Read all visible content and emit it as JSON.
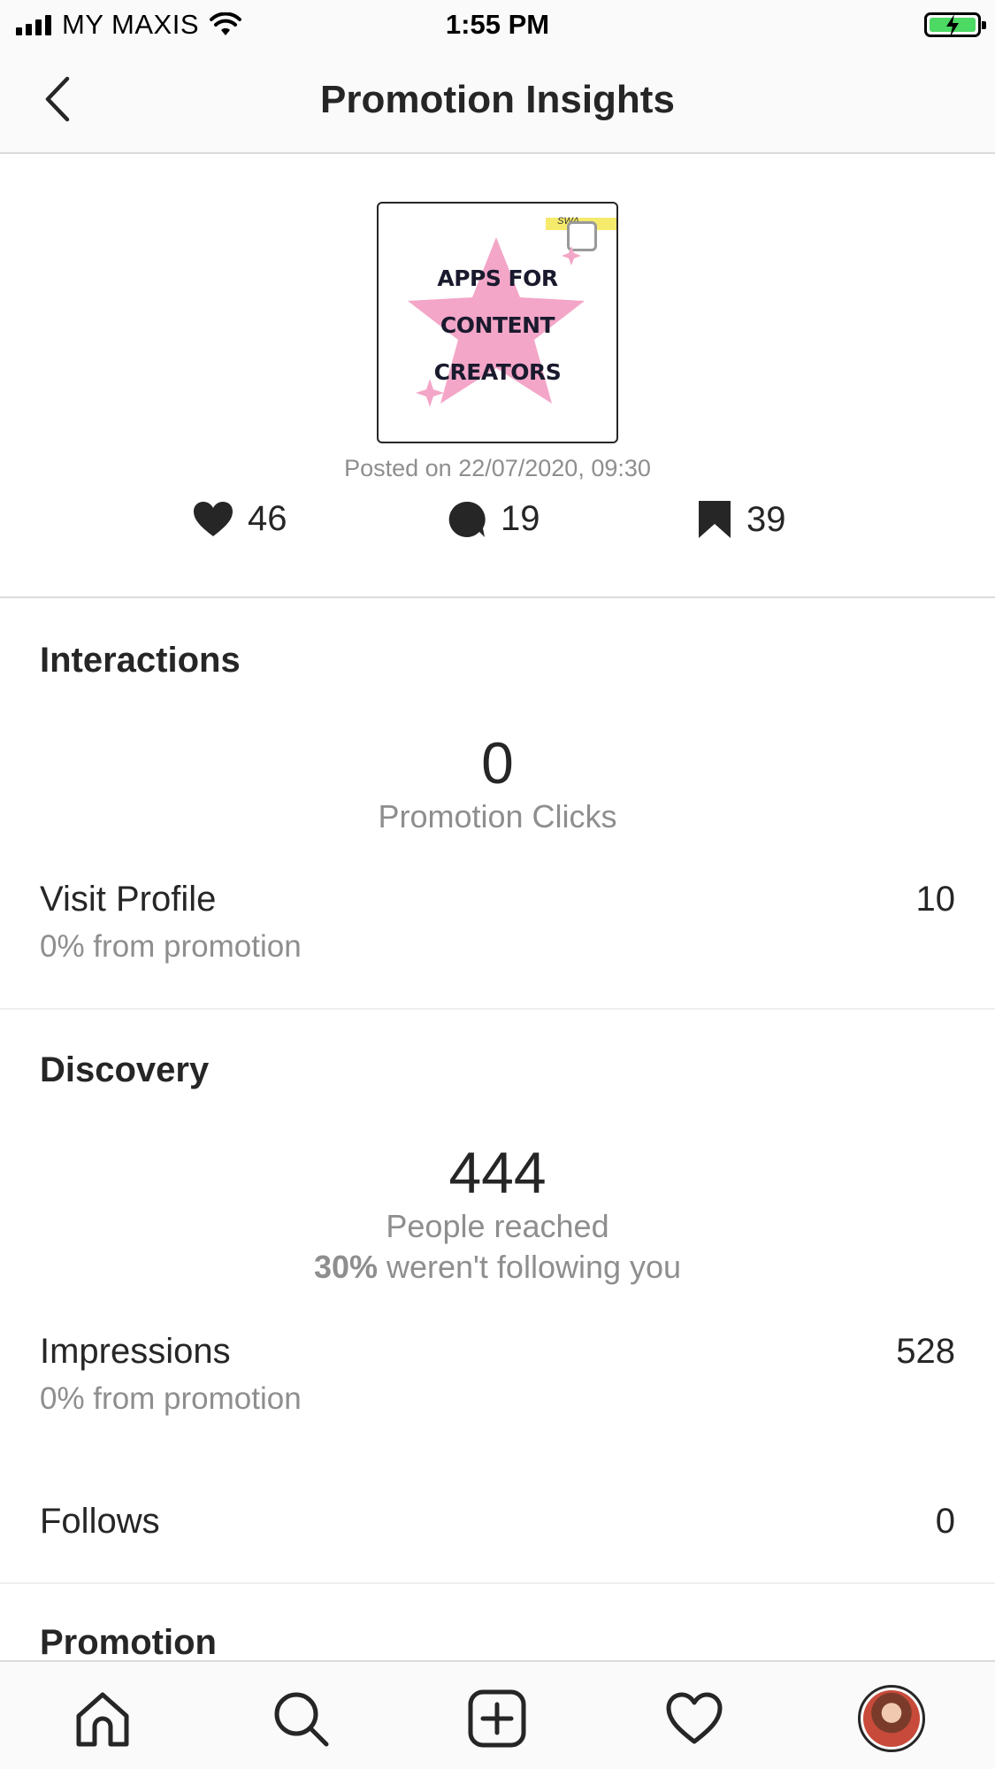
{
  "status_bar": {
    "carrier": "MY MAXIS",
    "time": "1:55 PM"
  },
  "nav": {
    "title": "Promotion Insights"
  },
  "post": {
    "thumbnail_text": [
      "APPS FOR",
      "CONTENT",
      "CREATORS"
    ],
    "thumbnail_badge": "SWA",
    "posted": "Posted on 22/07/2020, 09:30",
    "likes": "46",
    "comments": "19",
    "saves": "39"
  },
  "interactions": {
    "title": "Interactions",
    "promotion_clicks_value": "0",
    "promotion_clicks_label": "Promotion Clicks",
    "visit_profile_label": "Visit Profile",
    "visit_profile_sub": "0% from promotion",
    "visit_profile_value": "10"
  },
  "discovery": {
    "title": "Discovery",
    "reach_value": "444",
    "reach_label": "People reached",
    "not_following_pct": "30%",
    "not_following_text": " weren't following you",
    "impressions_label": "Impressions",
    "impressions_sub": "0% from promotion",
    "impressions_value": "528",
    "follows_label": "Follows",
    "follows_value": "0"
  },
  "promotion": {
    "title": "Promotion"
  },
  "tab_bar": {
    "tabs": [
      "home-icon",
      "search-icon",
      "add-post-icon",
      "heart-icon",
      "profile-avatar"
    ]
  },
  "colors": {
    "text_primary": "#262626",
    "text_secondary": "#8e8e8e",
    "divider": "#dbdbdb",
    "battery": "#4cd964",
    "thumbnail_star": "#f3a6c8"
  }
}
